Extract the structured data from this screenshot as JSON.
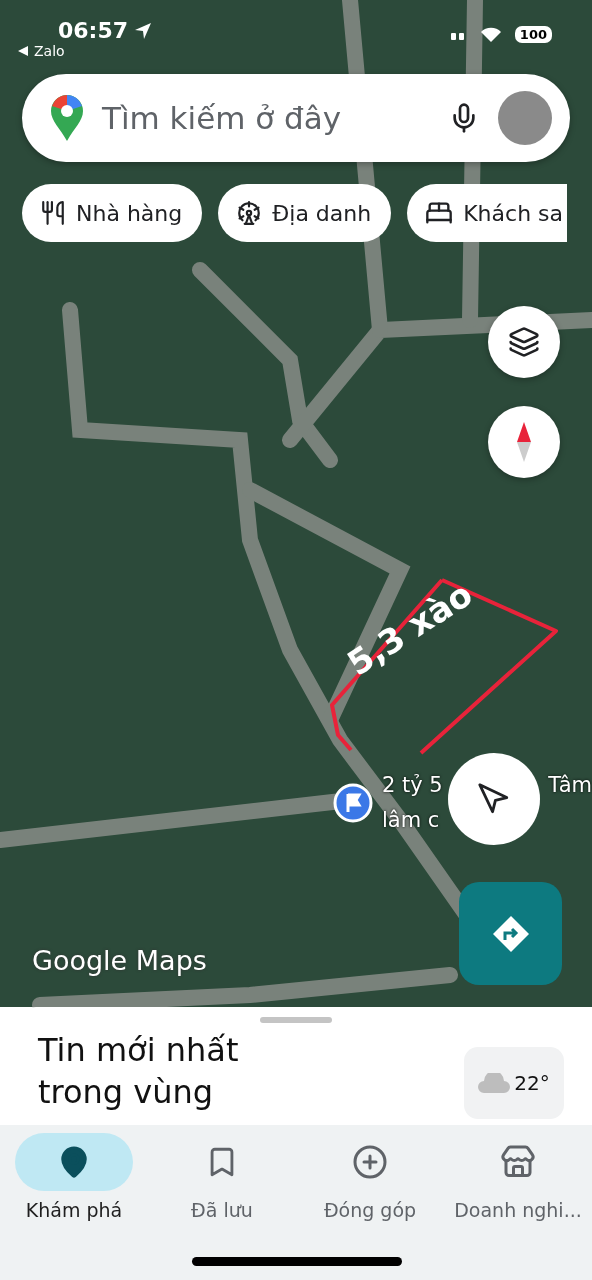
{
  "status_bar": {
    "time": "06:57",
    "back_app": "Zalo",
    "battery": "100"
  },
  "search": {
    "placeholder": "Tìm kiếm ở đây"
  },
  "chips": [
    {
      "label": "Nhà hàng",
      "kind": "restaurant"
    },
    {
      "label": "Địa danh",
      "kind": "landmark"
    },
    {
      "label": "Khách sa",
      "kind": "hotel"
    }
  ],
  "map": {
    "area_label": "5,3 xào",
    "pin_label_line_1": "2 tỷ 5",
    "pin_label_cut": "Tâm",
    "pin_label_line_2": "lâm c",
    "attribution": "Google Maps"
  },
  "sheet": {
    "title": "Tin mới nhất trong vùng",
    "weather": "22°"
  },
  "nav": [
    {
      "label": "Khám phá",
      "kind": "explore",
      "selected": true
    },
    {
      "label": "Đã lưu",
      "kind": "saved",
      "selected": false
    },
    {
      "label": "Đóng góp",
      "kind": "contribute",
      "selected": false
    },
    {
      "label": "Doanh nghi...",
      "kind": "business",
      "selected": false
    }
  ]
}
